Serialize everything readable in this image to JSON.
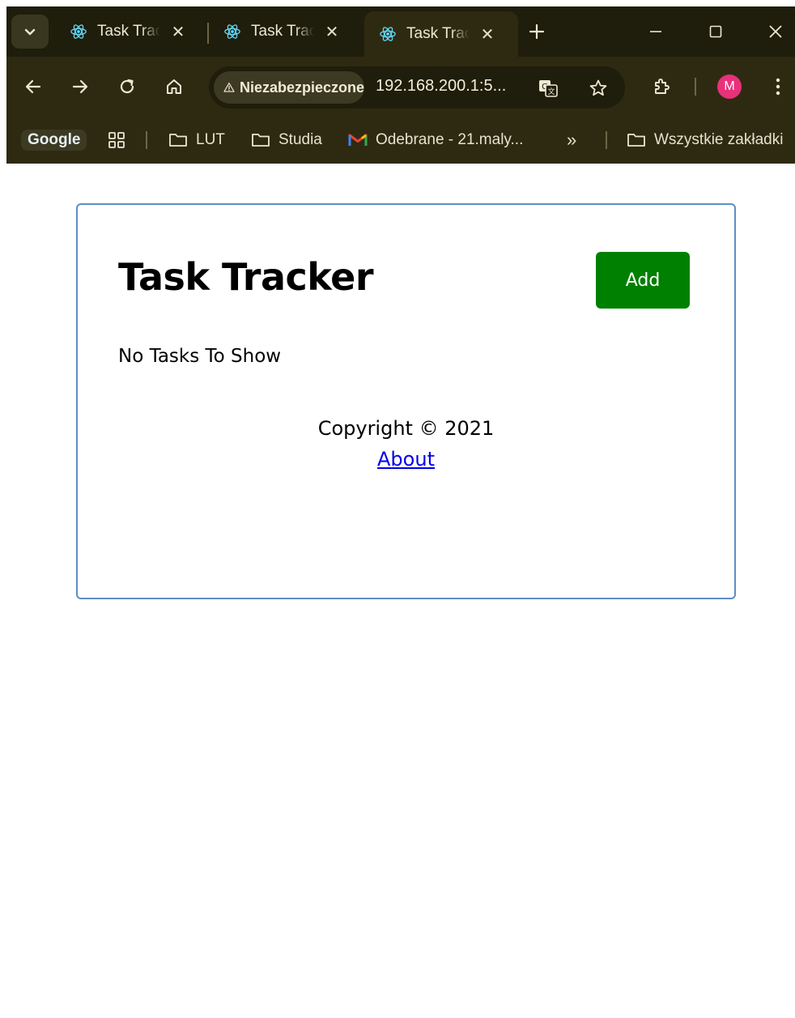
{
  "browser": {
    "tabs": [
      {
        "title": "Task Tracker",
        "active": false
      },
      {
        "title": "Task Tracker",
        "active": false
      },
      {
        "title": "Task Tracker",
        "active": true
      }
    ],
    "address": {
      "security_label": "Niezabezpieczone",
      "url": "192.168.200.1:5..."
    },
    "profile_initial": "M",
    "bookmarks": {
      "google": "Google",
      "items": [
        {
          "label": "LUT",
          "icon": "folder-icon"
        },
        {
          "label": "Studia",
          "icon": "folder-icon"
        },
        {
          "label": "Odebrane - 21.maly...",
          "icon": "gmail-icon"
        }
      ],
      "overflow": "»",
      "all_bookmarks": "Wszystkie zakładki"
    },
    "colors": {
      "frame": "#1f1d0b",
      "toolbar": "#2e2a12",
      "avatar": "#e8317a"
    }
  },
  "app": {
    "title": "Task Tracker",
    "add_button": "Add",
    "empty_message": "No Tasks To Show",
    "footer": {
      "copyright": "Copyright © 2021",
      "about_link": "About"
    },
    "colors": {
      "add_button": "#008000",
      "border": "#5b8fc4",
      "link": "#0000ee"
    }
  }
}
